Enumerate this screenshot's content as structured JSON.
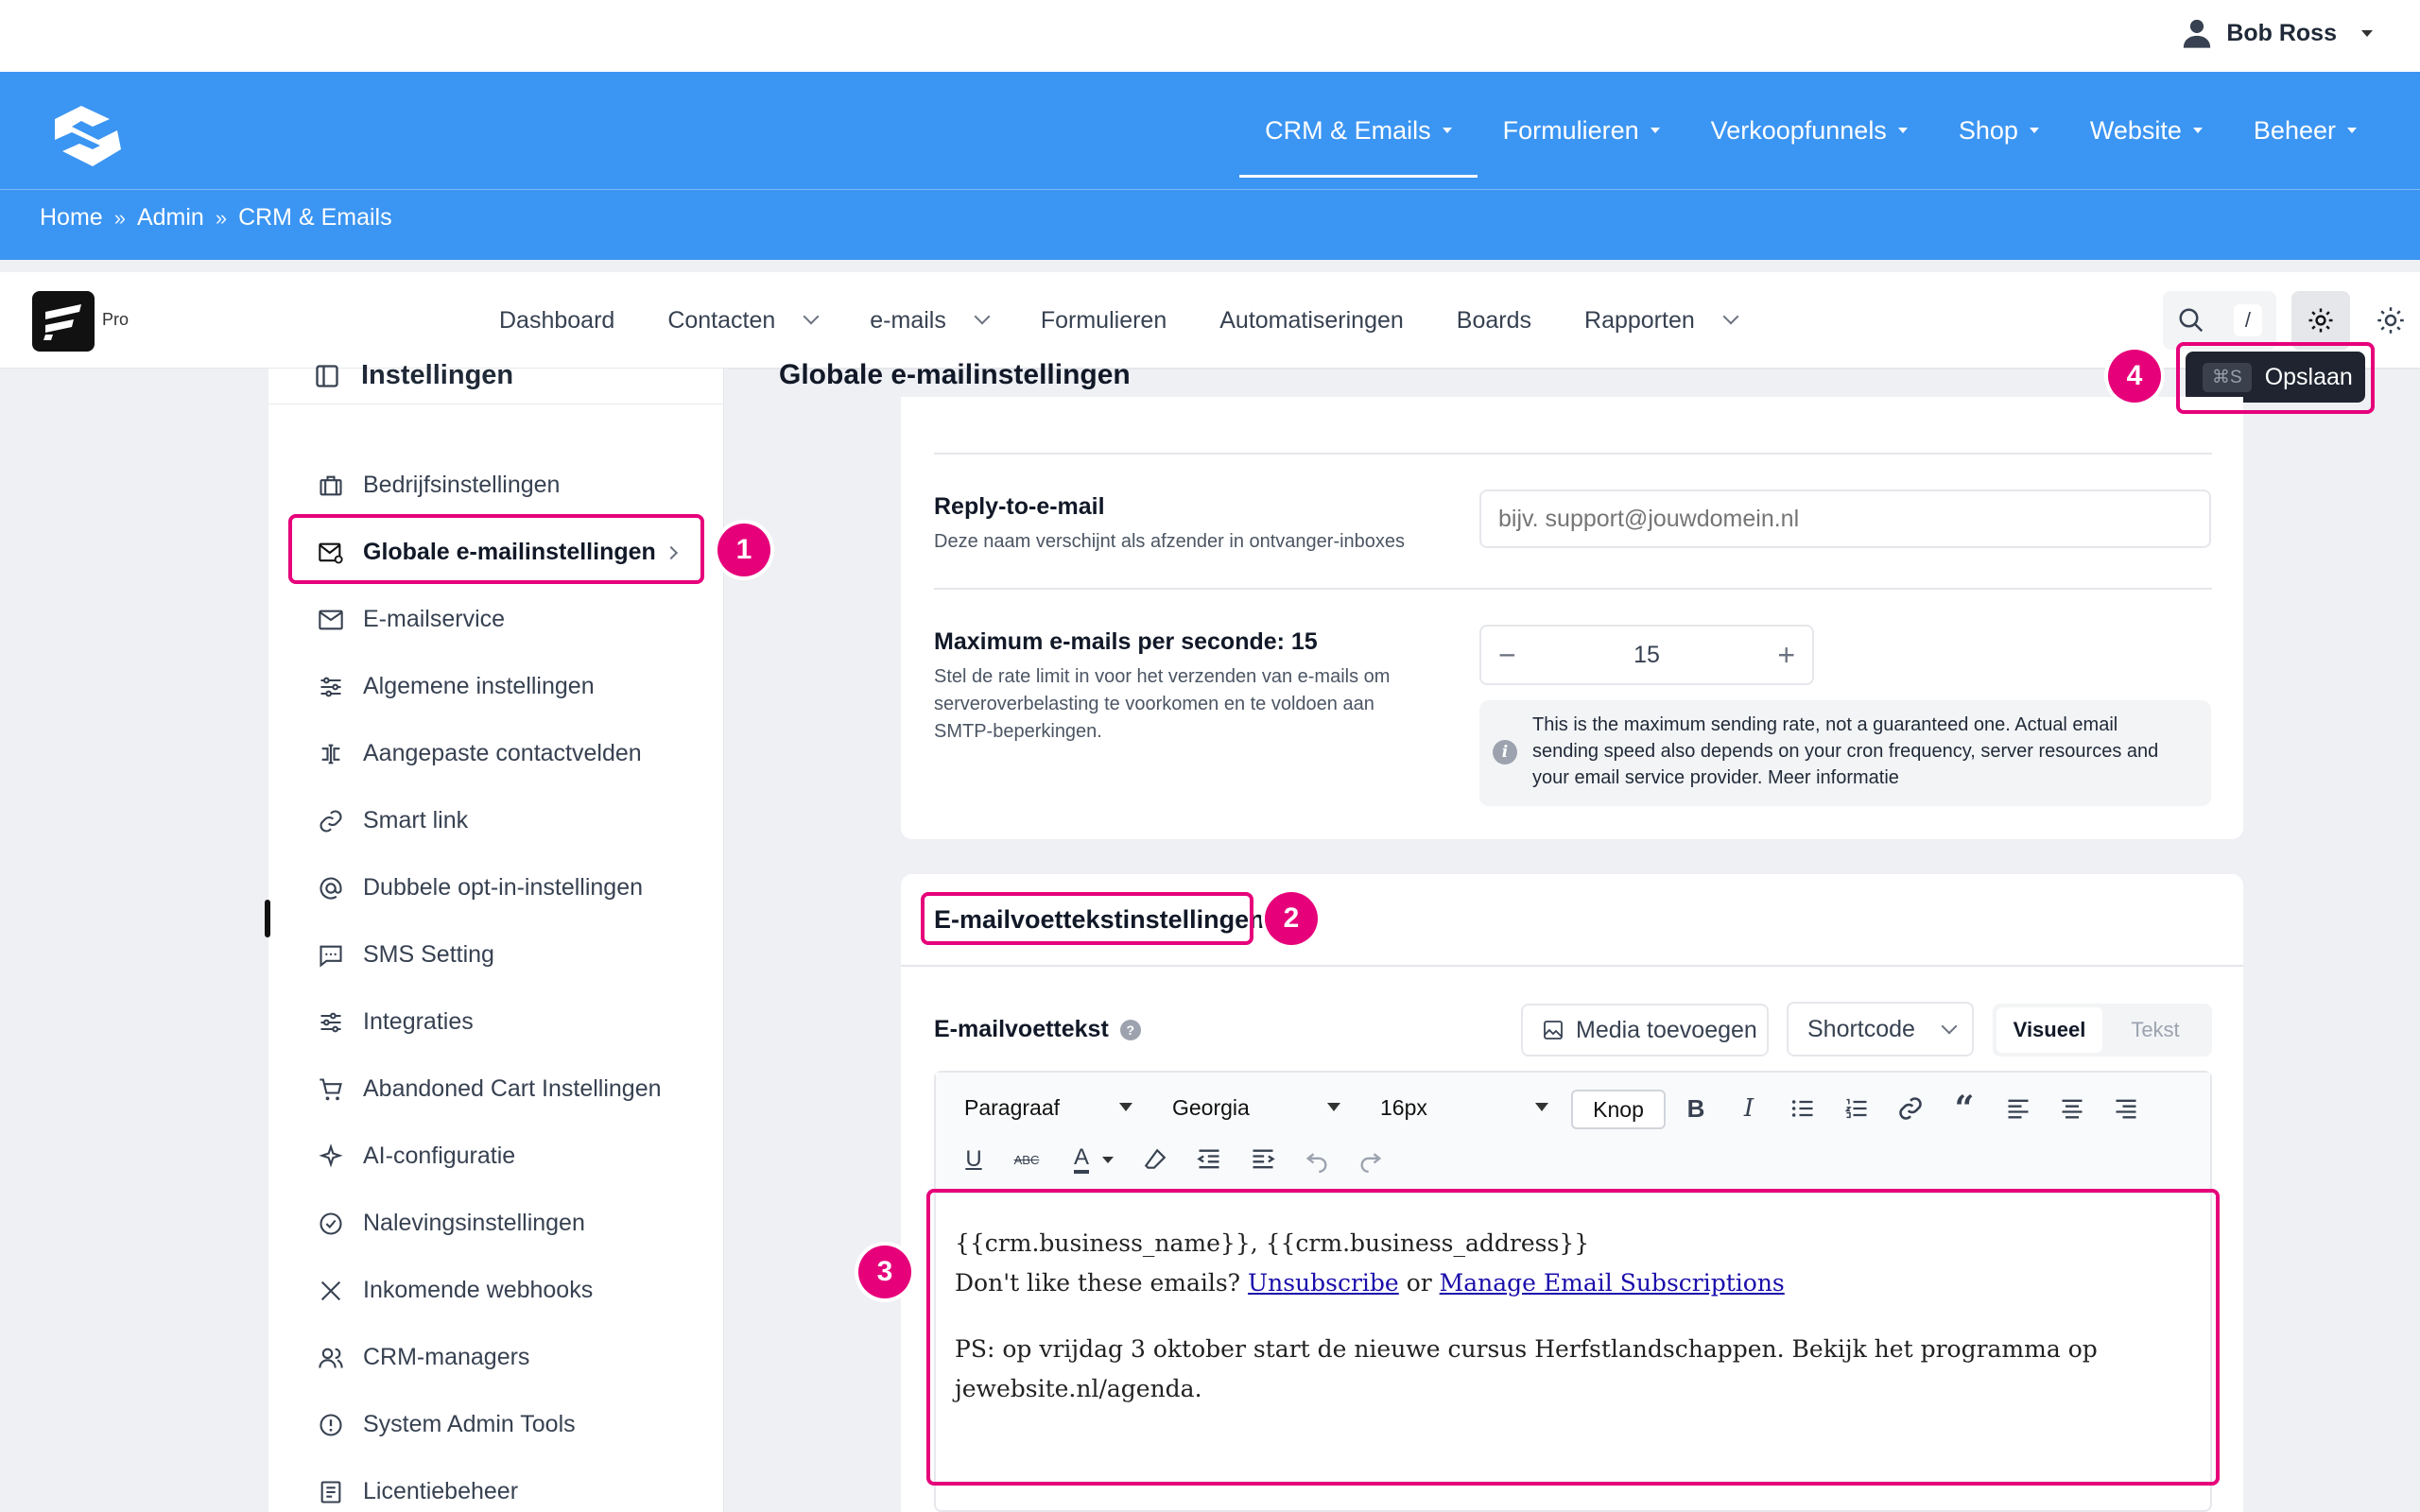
{
  "user": {
    "name": "Bob Ross"
  },
  "main_nav": {
    "items": [
      "CRM & Emails",
      "Formulieren",
      "Verkoopfunnels",
      "Shop",
      "Website",
      "Beheer"
    ]
  },
  "breadcrumb": {
    "items": [
      "Home",
      "Admin",
      "CRM & Emails"
    ],
    "sep": "»"
  },
  "app": {
    "badge": "Pro",
    "nav": [
      "Dashboard",
      "Contacten",
      "e-mails",
      "Formulieren",
      "Automatiseringen",
      "Boards",
      "Rapporten"
    ],
    "search_shortcut": "/"
  },
  "sidebar": {
    "title": "Instellingen",
    "items": [
      "Bedrijfsinstellingen",
      "Globale e-mailinstellingen",
      "E-mailservice",
      "Algemene instellingen",
      "Aangepaste contactvelden",
      "Smart link",
      "Dubbele opt-in-instellingen",
      "SMS Setting",
      "Integraties",
      "Abandoned Cart Instellingen",
      "AI-configuratie",
      "Nalevingsinstellingen",
      "Inkomende webhooks",
      "CRM-managers",
      "System Admin Tools",
      "Licentiebeheer"
    ]
  },
  "page": {
    "title": "Globale e-mailinstellingen",
    "save_shortcut": "⌘S",
    "save_label": "Opslaan"
  },
  "reply_to": {
    "label": "Reply-to-e-mail",
    "description": "Deze naam verschijnt als afzender in ontvanger-inboxes",
    "placeholder": "bijv. support@jouwdomein.nl"
  },
  "max_emails": {
    "label": "Maximum e-mails per seconde: 15",
    "description_lines": [
      "Stel de rate limit in voor het verzenden van e-mails om",
      "serveroverbelasting te voorkomen en te voldoen aan",
      "SMTP-beperkingen."
    ],
    "value": "15",
    "minus": "−",
    "plus": "+",
    "info_lines": [
      "This is the maximum sending rate, not a guaranteed one. Actual email",
      "sending speed also depends on your cron frequency, server resources and",
      "your email service provider. Meer informatie"
    ],
    "info_icon": "i"
  },
  "footer_section": {
    "title": "E-mailvoettekstinstellingen",
    "field_label": "E-mailvoettekst",
    "help_icon": "?",
    "media_button": "Media toevoegen",
    "shortcode": "Shortcode",
    "mode_visual": "Visueel",
    "mode_text": "Tekst"
  },
  "editor": {
    "format": "Paragraaf",
    "font": "Georgia",
    "size": "16px",
    "button_label": "Knop",
    "line1": "{{crm.business_name}}, {{crm.business_address}}",
    "line2_prefix": "Don't like these emails?",
    "unsubscribe": "Unsubscribe",
    "or": "or",
    "manage": "Manage Email Subscriptions",
    "ps_line1": "PS: op vrijdag 3 oktober start de nieuwe cursus Herfstlandschappen. Bekijk het programma op",
    "ps_line2": "jewebsite.nl/agenda."
  },
  "annotations": [
    "1",
    "2",
    "3",
    "4"
  ],
  "colors": {
    "blue_header": "#3b95f2",
    "highlight": "#e6007a",
    "save_button": "#1f2430"
  }
}
